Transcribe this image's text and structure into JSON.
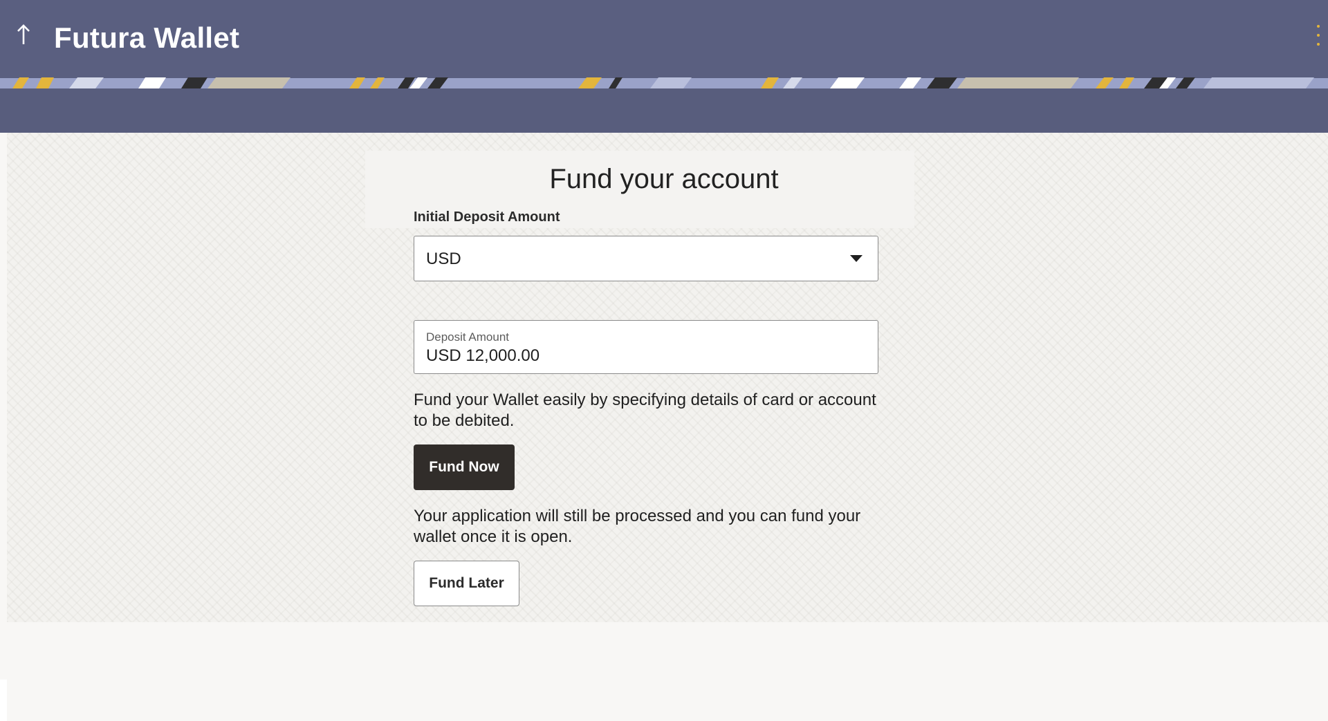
{
  "header": {
    "title": "Futura Wallet",
    "back_icon": "arrow-up-icon",
    "menu_icon": "kebab-menu-icon",
    "background_color": "#5a5f80",
    "accent_color": "#e3b53c"
  },
  "form": {
    "heading": "Fund your account",
    "deposit_label": "Initial Deposit Amount",
    "currency": {
      "selected": "USD"
    },
    "amount": {
      "label": "Deposit Amount",
      "value": "USD 12,000.00"
    },
    "fund_now_text": "Fund your Wallet easily by specifying details of card or account to be debited.",
    "fund_now_button": "Fund Now",
    "fund_later_text": "Your application will still be processed and you can fund your wallet once it is open.",
    "fund_later_button": "Fund Later"
  }
}
